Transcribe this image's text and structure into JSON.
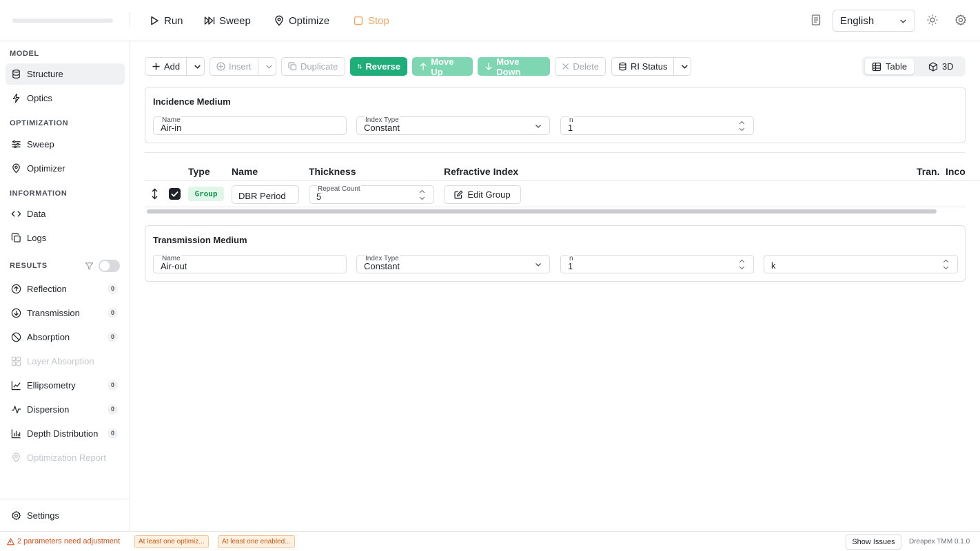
{
  "topbar": {
    "run_label": "Run",
    "sweep_label": "Sweep",
    "optimize_label": "Optimize",
    "stop_label": "Stop",
    "language": "English"
  },
  "sidebar": {
    "model_title": "MODEL",
    "optimization_title": "OPTIMIZATION",
    "information_title": "INFORMATION",
    "results_title": "RESULTS",
    "items": {
      "structure": "Structure",
      "optics": "Optics",
      "sweep": "Sweep",
      "optimizer": "Optimizer",
      "data": "Data",
      "logs": "Logs",
      "reflection": "Reflection",
      "transmission": "Transmission",
      "absorption": "Absorption",
      "layer_absorption": "Layer Absorption",
      "ellipsometry": "Ellipsometry",
      "dispersion": "Dispersion",
      "depth_distribution": "Depth Distribution",
      "optimization_report": "Optimization Report",
      "settings": "Settings"
    },
    "counts": {
      "reflection": "0",
      "transmission": "0",
      "absorption": "0",
      "ellipsometry": "0",
      "dispersion": "0",
      "depth_distribution": "0"
    }
  },
  "toolbar": {
    "add": "Add",
    "insert": "Insert",
    "duplicate": "Duplicate",
    "reverse": "Reverse",
    "move_up": "Move Up",
    "move_down": "Move Down",
    "delete": "Delete",
    "ri_status": "RI Status",
    "view_table": "Table",
    "view_3d": "3D"
  },
  "incidence": {
    "title": "Incidence Medium",
    "name_label": "Name",
    "name_value": "Air-in",
    "index_type_label": "Index Type",
    "index_type_value": "Constant",
    "n_label": "n",
    "n_value": "1"
  },
  "table": {
    "headers": {
      "type": "Type",
      "name": "Name",
      "thickness": "Thickness",
      "refractive_index": "Refractive Index",
      "tran": "Tran.",
      "inco": "Inco"
    },
    "row": {
      "type_badge": "Group",
      "name": "DBR Period",
      "repeat_label": "Repeat Count",
      "repeat_value": "5",
      "edit_group": "Edit Group",
      "checked": true
    }
  },
  "transmission": {
    "title": "Transmission Medium",
    "name_label": "Name",
    "name_value": "Air-out",
    "index_type_label": "Index Type",
    "index_type_value": "Constant",
    "n_label": "n",
    "n_value": "1",
    "k_placeholder": "k"
  },
  "statusbar": {
    "warning": "2 parameters need adjustment",
    "chip1": "At least one optimiz...",
    "chip2": "At least one enabled...",
    "show_issues": "Show Issues",
    "version": "Dreapex TMM 0.1.0"
  },
  "colors": {
    "accent_green": "#1fae7a",
    "accent_green_light": "#7fd6b2",
    "stop_orange": "#f0a868",
    "warning_orange": "#d9501b"
  }
}
